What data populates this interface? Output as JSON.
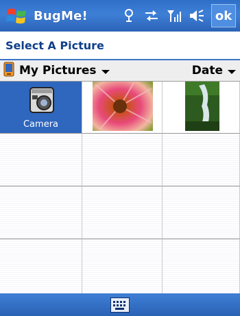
{
  "titlebar": {
    "app_title": "BugMe!",
    "ok_label": "ok",
    "icons": [
      "windows-flag-icon",
      "speaker-tune-icon",
      "connectivity-icon",
      "signal-icon",
      "volume-icon"
    ]
  },
  "header": {
    "caption": "Select A Picture"
  },
  "filterbar": {
    "folder_label": "My Pictures",
    "sort_label": "Date"
  },
  "grid": {
    "items": [
      {
        "label": "Camera",
        "kind": "camera",
        "selected": true
      },
      {
        "label": "",
        "kind": "flower-photo"
      },
      {
        "label": "",
        "kind": "waterfall-photo"
      }
    ]
  },
  "colors": {
    "title_blue": "#2f6fc9",
    "caption_text": "#0f3f8a",
    "selection_blue": "#2f66be"
  },
  "menubar": {
    "icons": [
      "keyboard-icon"
    ]
  }
}
